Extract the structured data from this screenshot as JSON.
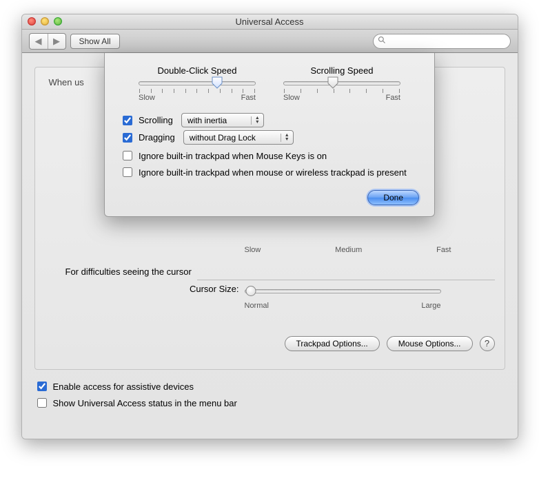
{
  "window": {
    "title": "Universal Access"
  },
  "toolbar": {
    "showAll": "Show All",
    "searchPlaceholder": ""
  },
  "main": {
    "introPartial": "When us",
    "bgScaleSlow": "Slow",
    "bgScaleMedium": "Medium",
    "bgScaleFast": "Fast",
    "cursorSection": "For difficulties seeing the cursor",
    "cursorSizeLabel": "Cursor Size:",
    "cursorNormal": "Normal",
    "cursorLarge": "Large",
    "trackpadOptions": "Trackpad Options...",
    "mouseOptions": "Mouse Options..."
  },
  "footer": {
    "enableAssistive": "Enable access for assistive devices",
    "showStatus": "Show Universal Access status in the menu bar"
  },
  "sheet": {
    "dblClick": {
      "title": "Double-Click Speed",
      "slow": "Slow",
      "fast": "Fast"
    },
    "scrollSpeed": {
      "title": "Scrolling Speed",
      "slow": "Slow",
      "fast": "Fast"
    },
    "scrolling": {
      "label": "Scrolling",
      "value": "with inertia"
    },
    "dragging": {
      "label": "Dragging",
      "value": "without Drag Lock"
    },
    "ignoreMouseKeys": "Ignore built-in trackpad when Mouse Keys is on",
    "ignoreWireless": "Ignore built-in trackpad when mouse or wireless trackpad is present",
    "done": "Done"
  }
}
